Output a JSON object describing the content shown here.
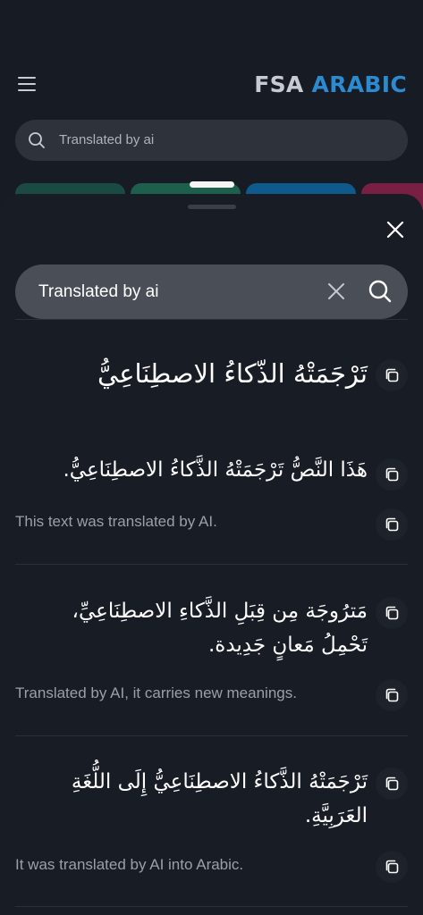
{
  "header": {
    "logo_part1": "FSA",
    "logo_part2": "ARABIC",
    "search_text": "Translated by ai"
  },
  "colors": {
    "background": "#171b23",
    "accent": "#2b8ad0",
    "chip_colors": [
      "#1a4a42",
      "#1e5e4c",
      "#0e5a8c",
      "#7a1f44"
    ]
  },
  "sheet": {
    "search_value": "Translated by ai",
    "title_arabic": "تَرْجَمَتْهُ الذّكاءُ الاصطِنَاعِيُّ",
    "results": [
      {
        "arabic": "هَذَا النَّصُّ تَرْجَمَتْهُ الذَّكاءُ الاصطِنَاعِيُّ.",
        "english": "This text was translated by AI."
      },
      {
        "arabic_line1": "مَترُوجَة مِن قِبَلِ الذَّكاءِ الاصطِنَاعِيِّ،",
        "arabic_line2": "تَحْمِلُ مَعانٍ جَدِيدة.",
        "english": "Translated by AI, it carries new meanings."
      },
      {
        "arabic_line1": "تَرْجَمَتْهُ الذَّكاءُ الاصطِنَاعِيُّ إِلَى اللُّغَةِ",
        "arabic_line2": "العَرَبِيَّةِ.",
        "english": "It was translated by AI into Arabic."
      }
    ]
  },
  "icons": [
    "menu-icon",
    "search-icon",
    "close-icon",
    "clear-icon",
    "copy-icon"
  ]
}
